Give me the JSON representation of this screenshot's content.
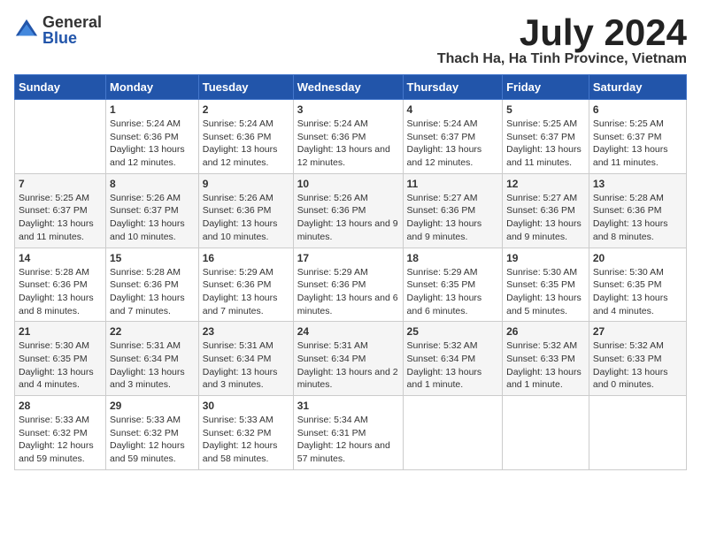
{
  "logo": {
    "general": "General",
    "blue": "Blue"
  },
  "title": "July 2024",
  "location": "Thach Ha, Ha Tinh Province, Vietnam",
  "headers": [
    "Sunday",
    "Monday",
    "Tuesday",
    "Wednesday",
    "Thursday",
    "Friday",
    "Saturday"
  ],
  "weeks": [
    [
      {
        "day": "",
        "info": ""
      },
      {
        "day": "1",
        "info": "Sunrise: 5:24 AM\nSunset: 6:36 PM\nDaylight: 13 hours\nand 12 minutes."
      },
      {
        "day": "2",
        "info": "Sunrise: 5:24 AM\nSunset: 6:36 PM\nDaylight: 13 hours\nand 12 minutes."
      },
      {
        "day": "3",
        "info": "Sunrise: 5:24 AM\nSunset: 6:36 PM\nDaylight: 13 hours\nand 12 minutes."
      },
      {
        "day": "4",
        "info": "Sunrise: 5:24 AM\nSunset: 6:37 PM\nDaylight: 13 hours\nand 12 minutes."
      },
      {
        "day": "5",
        "info": "Sunrise: 5:25 AM\nSunset: 6:37 PM\nDaylight: 13 hours\nand 11 minutes."
      },
      {
        "day": "6",
        "info": "Sunrise: 5:25 AM\nSunset: 6:37 PM\nDaylight: 13 hours\nand 11 minutes."
      }
    ],
    [
      {
        "day": "7",
        "info": "Sunrise: 5:25 AM\nSunset: 6:37 PM\nDaylight: 13 hours\nand 11 minutes."
      },
      {
        "day": "8",
        "info": "Sunrise: 5:26 AM\nSunset: 6:37 PM\nDaylight: 13 hours\nand 10 minutes."
      },
      {
        "day": "9",
        "info": "Sunrise: 5:26 AM\nSunset: 6:36 PM\nDaylight: 13 hours\nand 10 minutes."
      },
      {
        "day": "10",
        "info": "Sunrise: 5:26 AM\nSunset: 6:36 PM\nDaylight: 13 hours\nand 9 minutes."
      },
      {
        "day": "11",
        "info": "Sunrise: 5:27 AM\nSunset: 6:36 PM\nDaylight: 13 hours\nand 9 minutes."
      },
      {
        "day": "12",
        "info": "Sunrise: 5:27 AM\nSunset: 6:36 PM\nDaylight: 13 hours\nand 9 minutes."
      },
      {
        "day": "13",
        "info": "Sunrise: 5:28 AM\nSunset: 6:36 PM\nDaylight: 13 hours\nand 8 minutes."
      }
    ],
    [
      {
        "day": "14",
        "info": "Sunrise: 5:28 AM\nSunset: 6:36 PM\nDaylight: 13 hours\nand 8 minutes."
      },
      {
        "day": "15",
        "info": "Sunrise: 5:28 AM\nSunset: 6:36 PM\nDaylight: 13 hours\nand 7 minutes."
      },
      {
        "day": "16",
        "info": "Sunrise: 5:29 AM\nSunset: 6:36 PM\nDaylight: 13 hours\nand 7 minutes."
      },
      {
        "day": "17",
        "info": "Sunrise: 5:29 AM\nSunset: 6:36 PM\nDaylight: 13 hours\nand 6 minutes."
      },
      {
        "day": "18",
        "info": "Sunrise: 5:29 AM\nSunset: 6:35 PM\nDaylight: 13 hours\nand 6 minutes."
      },
      {
        "day": "19",
        "info": "Sunrise: 5:30 AM\nSunset: 6:35 PM\nDaylight: 13 hours\nand 5 minutes."
      },
      {
        "day": "20",
        "info": "Sunrise: 5:30 AM\nSunset: 6:35 PM\nDaylight: 13 hours\nand 4 minutes."
      }
    ],
    [
      {
        "day": "21",
        "info": "Sunrise: 5:30 AM\nSunset: 6:35 PM\nDaylight: 13 hours\nand 4 minutes."
      },
      {
        "day": "22",
        "info": "Sunrise: 5:31 AM\nSunset: 6:34 PM\nDaylight: 13 hours\nand 3 minutes."
      },
      {
        "day": "23",
        "info": "Sunrise: 5:31 AM\nSunset: 6:34 PM\nDaylight: 13 hours\nand 3 minutes."
      },
      {
        "day": "24",
        "info": "Sunrise: 5:31 AM\nSunset: 6:34 PM\nDaylight: 13 hours\nand 2 minutes."
      },
      {
        "day": "25",
        "info": "Sunrise: 5:32 AM\nSunset: 6:34 PM\nDaylight: 13 hours\nand 1 minute."
      },
      {
        "day": "26",
        "info": "Sunrise: 5:32 AM\nSunset: 6:33 PM\nDaylight: 13 hours\nand 1 minute."
      },
      {
        "day": "27",
        "info": "Sunrise: 5:32 AM\nSunset: 6:33 PM\nDaylight: 13 hours\nand 0 minutes."
      }
    ],
    [
      {
        "day": "28",
        "info": "Sunrise: 5:33 AM\nSunset: 6:32 PM\nDaylight: 12 hours\nand 59 minutes."
      },
      {
        "day": "29",
        "info": "Sunrise: 5:33 AM\nSunset: 6:32 PM\nDaylight: 12 hours\nand 59 minutes."
      },
      {
        "day": "30",
        "info": "Sunrise: 5:33 AM\nSunset: 6:32 PM\nDaylight: 12 hours\nand 58 minutes."
      },
      {
        "day": "31",
        "info": "Sunrise: 5:34 AM\nSunset: 6:31 PM\nDaylight: 12 hours\nand 57 minutes."
      },
      {
        "day": "",
        "info": ""
      },
      {
        "day": "",
        "info": ""
      },
      {
        "day": "",
        "info": ""
      }
    ]
  ]
}
